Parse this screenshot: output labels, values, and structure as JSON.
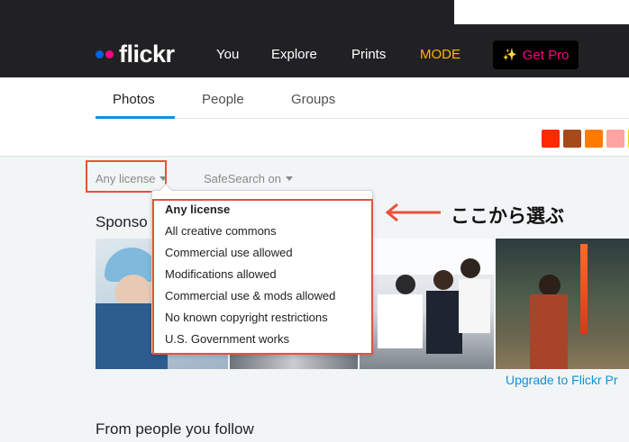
{
  "header": {
    "logo_text": "flickr",
    "nav": [
      "You",
      "Explore",
      "Prints",
      "MODE"
    ],
    "get_pro": "Get Pro"
  },
  "tabs": [
    "Photos",
    "People",
    "Groups"
  ],
  "active_tab": "Photos",
  "color_swatches": [
    "#ff2a00",
    "#a6491b",
    "#ff7b00",
    "#ffa3a3"
  ],
  "filters": {
    "license": "Any license",
    "safesearch": "SafeSearch on"
  },
  "license_menu": {
    "options": [
      "Any license",
      "All creative commons",
      "Commercial use allowed",
      "Modifications allowed",
      "Commercial use & mods allowed",
      "No known copyright restrictions",
      "U.S. Government works"
    ],
    "selected": "Any license"
  },
  "sections": {
    "sponsored": "Sponso",
    "upgrade_link": "Upgrade to Flickr Pr",
    "from_follow": "From people you follow"
  },
  "annotation": {
    "text": "ここから選ぶ",
    "color": "#e8523a"
  },
  "colors": {
    "header_bg": "#212124",
    "accent_blue": "#128fdc",
    "pink": "#ff0084",
    "mode_yellow": "#ffb400"
  }
}
